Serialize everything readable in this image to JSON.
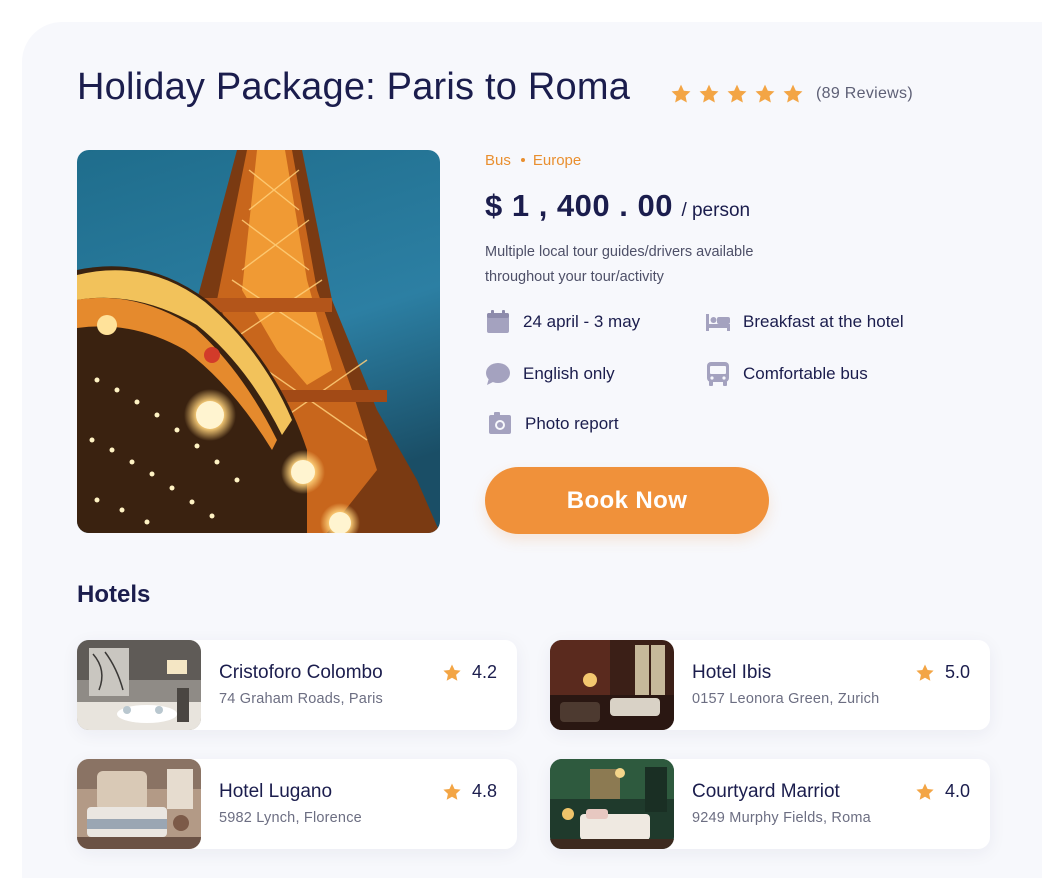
{
  "package": {
    "title": "Holiday Package: Paris to Roma",
    "star_count": 5,
    "reviews_text": "(89  Reviews)",
    "tags": [
      "Bus",
      "Europe"
    ],
    "price": "$ 1 , 400 . 00",
    "price_unit": "/ person",
    "description": "Multiple local tour guides/drivers available throughout your tour/activity",
    "features": {
      "dates": "24 april - 3 may",
      "breakfast": "Breakfast at the hotel",
      "language": "English only",
      "transport": "Comfortable bus",
      "photo": "Photo report"
    },
    "book_label": "Book Now",
    "icons": {
      "dates": "calendar-icon",
      "breakfast": "bed-icon",
      "language": "chat-bubble-icon",
      "transport": "bus-icon",
      "photo": "camera-icon"
    }
  },
  "hotels": {
    "heading": "Hotels",
    "items": [
      {
        "name": "Cristoforo Colombo",
        "address": "74 Graham Roads, Paris",
        "rating": "4.2"
      },
      {
        "name": "Hotel Ibis",
        "address": "0157 Leonora Green, Zurich",
        "rating": "5.0"
      },
      {
        "name": "Hotel Lugano",
        "address": "5982 Lynch, Florence",
        "rating": "4.8"
      },
      {
        "name": "Courtyard Marriot",
        "address": "9249 Murphy Fields, Roma",
        "rating": "4.0"
      }
    ]
  },
  "colors": {
    "accent": "#f0913a",
    "tag": "#e98f2f",
    "star": "#f3a545",
    "text": "#1b1d4d",
    "icon": "#a4a2bf",
    "background": "#f7f8fc"
  }
}
